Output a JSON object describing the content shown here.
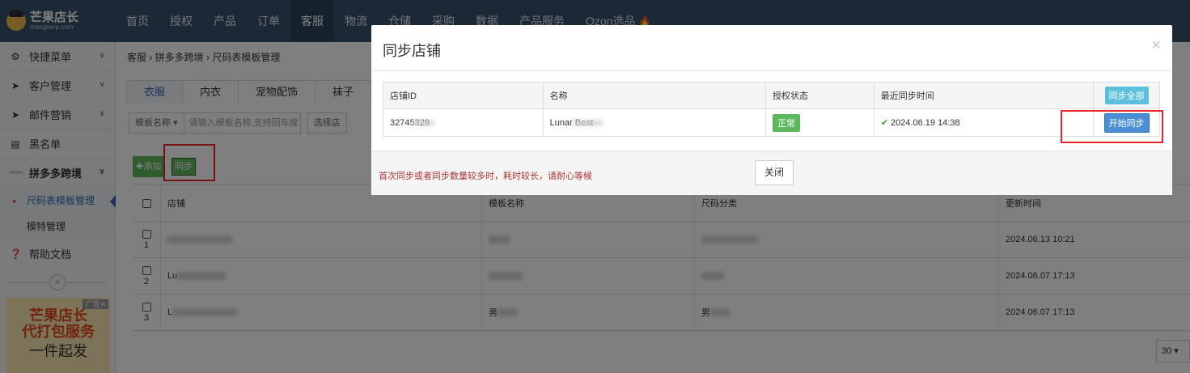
{
  "brand": {
    "name": "芒果店长",
    "sub": "mangoerp.com"
  },
  "topnav": [
    "首页",
    "授权",
    "产品",
    "订单",
    "客服",
    "物流",
    "仓储",
    "采购",
    "数据",
    "产品服务",
    "Ozon选品"
  ],
  "sidebar": {
    "items": [
      {
        "label": "快捷菜单"
      },
      {
        "label": "客户管理"
      },
      {
        "label": "邮件营销"
      },
      {
        "label": "黑名单"
      },
      {
        "label": "拼多多跨境"
      }
    ],
    "sub_items": [
      {
        "label": "尺码表模板管理"
      },
      {
        "label": "模特管理"
      }
    ],
    "help": "帮助文档",
    "ad": {
      "tag": "广告",
      "line1": "芒果店长",
      "line2": "代打包服务",
      "line3": "一件起发"
    }
  },
  "breadcrumb": "客服 › 拼多多跨境 › 尺码表模板管理",
  "tabs": [
    "衣服",
    "内衣",
    "宠物配饰",
    "袜子"
  ],
  "filter": {
    "select_label": "模板名称",
    "placeholder": "请输入模板名称,支持回车搜",
    "select2_label": "选择店"
  },
  "toolbar": {
    "add_label": "添加",
    "sync_label": "同步"
  },
  "table": {
    "headers": [
      "店铺",
      "模板名称",
      "尺码分类",
      "更新时间"
    ],
    "rows": [
      {
        "num": "1",
        "shop": "",
        "template": "",
        "category": "",
        "updated": "2024.06.13 10:21"
      },
      {
        "num": "2",
        "shop": "Lu",
        "template": "",
        "category": "",
        "updated": "2024.06.07 17:13"
      },
      {
        "num": "3",
        "shop": "L",
        "template": "男",
        "category": "男",
        "updated": "2024.06.07 17:13"
      }
    ],
    "page_size": "30"
  },
  "modal": {
    "title": "同步店铺",
    "close_icon": "×",
    "headers": [
      "店铺ID",
      "名称",
      "授权状态",
      "最近同步时间"
    ],
    "sync_all_label": "同步全部",
    "rows": [
      {
        "shop_id": "32745329",
        "name": "Lunar Beat",
        "status": "正常",
        "last_sync": "2024.06.19 14:38",
        "action": "开始同步"
      }
    ],
    "footer_note": "首次同步或者同步数量较多时，耗时较长，请耐心等候",
    "close_label": "关闭"
  }
}
